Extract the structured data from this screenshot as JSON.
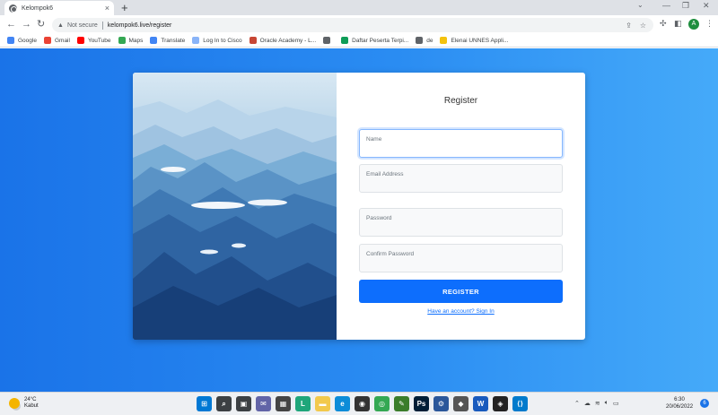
{
  "browser": {
    "tab_title": "Kelompok6",
    "tab_close": "×",
    "new_tab": "+",
    "security_label": "Not secure",
    "url": "kelompok6.live/register",
    "profile_initial": "A",
    "bookmarks": [
      {
        "label": "Google",
        "icon": "google-icon",
        "color": "#4285f4"
      },
      {
        "label": "Gmail",
        "icon": "gmail-icon",
        "color": "#ea4335"
      },
      {
        "label": "YouTube",
        "icon": "youtube-icon",
        "color": "#ff0000"
      },
      {
        "label": "Maps",
        "icon": "maps-icon",
        "color": "#34a853"
      },
      {
        "label": "Translate",
        "icon": "translate-icon",
        "color": "#4285f4"
      },
      {
        "label": "Log In to Cisco",
        "icon": "cisco-icon",
        "color": "#8ab4f8"
      },
      {
        "label": "Oracle Academy - L...",
        "icon": "oracle-icon",
        "color": "#c74634"
      },
      {
        "label": "",
        "icon": "globe-icon",
        "color": "#5f6368"
      },
      {
        "label": "Daftar Peserta Terpi...",
        "icon": "sheets-icon",
        "color": "#0f9d58"
      },
      {
        "label": "de",
        "icon": "globe-icon",
        "color": "#5f6368"
      },
      {
        "label": "Elenai UNNES Appli...",
        "icon": "unnes-icon",
        "color": "#f4c20d"
      }
    ]
  },
  "form": {
    "title": "Register",
    "name_label": "Name",
    "email_label": "Email Address",
    "password_label": "Password",
    "confirm_label": "Confirm Password",
    "submit_label": "REGISTER",
    "signin_link": "Have an account? Sign In"
  },
  "taskbar": {
    "temperature": "24°C",
    "weather_desc": "Kabut",
    "time": "6:30",
    "date": "20/06/2022",
    "notification_count": "6",
    "apps": [
      {
        "icon": "windows-start-icon",
        "color": "#0078d4"
      },
      {
        "icon": "search-icon",
        "color": "#3c4043"
      },
      {
        "icon": "task-view-icon",
        "color": "#3c4043"
      },
      {
        "icon": "chat-icon",
        "color": "#6264a7"
      },
      {
        "icon": "widgets-icon",
        "color": "#444"
      },
      {
        "icon": "line-icon",
        "color": "#1fa67a"
      },
      {
        "icon": "file-explorer-icon",
        "color": "#f2c94c"
      },
      {
        "icon": "edge-icon",
        "color": "#0c8cd8"
      },
      {
        "icon": "camera-icon",
        "color": "#333"
      },
      {
        "icon": "chrome-icon",
        "color": "#34a853"
      },
      {
        "icon": "pen-tool-icon",
        "color": "#3b7d2b"
      },
      {
        "icon": "photoshop-icon",
        "color": "#001e36"
      },
      {
        "icon": "settings-icon",
        "color": "#2b579a"
      },
      {
        "icon": "maps-app-icon",
        "color": "#555"
      },
      {
        "icon": "word-icon",
        "color": "#185abd"
      },
      {
        "icon": "unity-icon",
        "color": "#222"
      },
      {
        "icon": "vscode-icon",
        "color": "#007acc"
      }
    ]
  }
}
